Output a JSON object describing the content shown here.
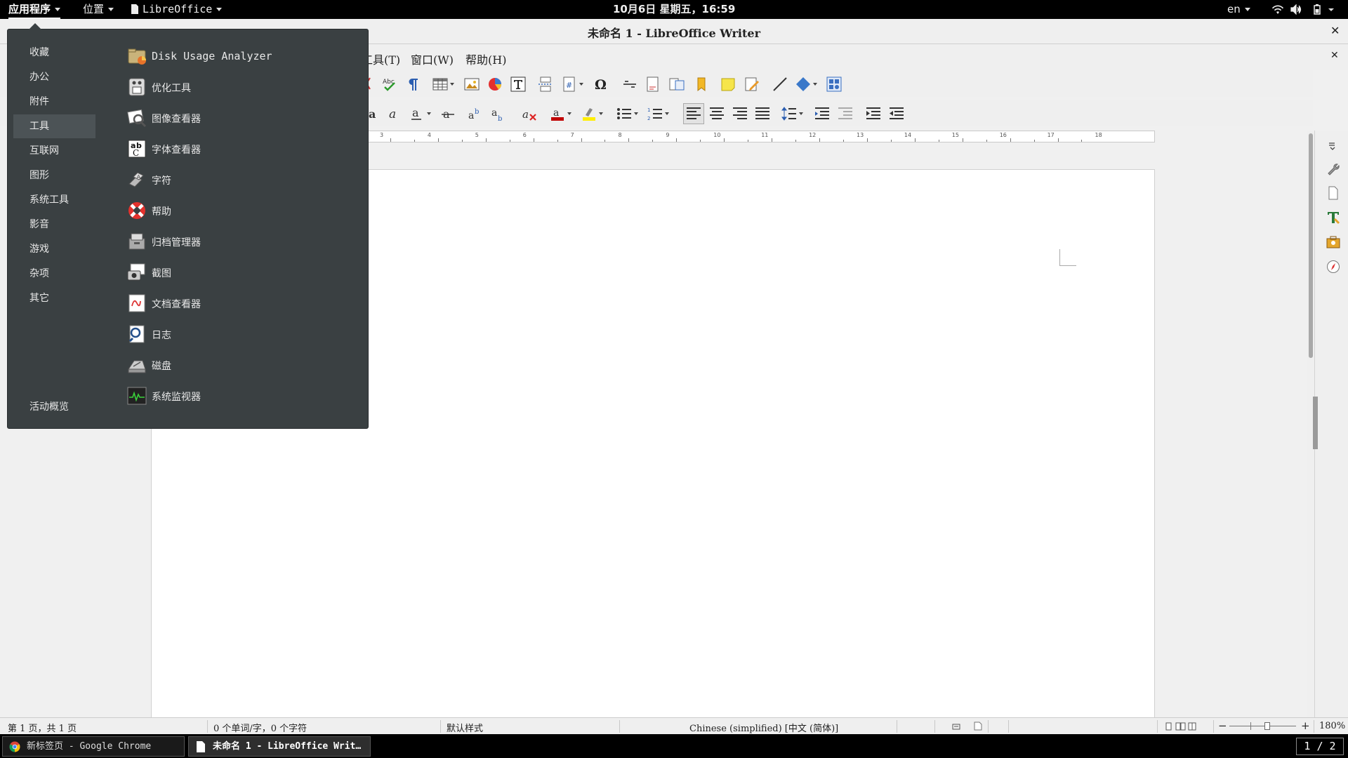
{
  "topbar": {
    "applications": "应用程序",
    "places": "位置",
    "app_name": "LibreOffice",
    "clock": "10月6日  星期五，16:59",
    "lang": "en"
  },
  "window": {
    "title": "未命名 1 - LibreOffice Writer"
  },
  "menubar": {
    "items": [
      "工具(T)",
      "窗口(W)",
      "帮助(H)"
    ]
  },
  "apps_menu": {
    "categories": [
      "收藏",
      "办公",
      "附件",
      "工具",
      "互联网",
      "图形",
      "系统工具",
      "影音",
      "游戏",
      "杂项",
      "其它"
    ],
    "selected_category": "工具",
    "activities": "活动概览",
    "apps": [
      {
        "label": "Disk Usage Analyzer",
        "icon": "disk-usage-analyzer-icon"
      },
      {
        "label": "优化工具",
        "icon": "tweaks-icon"
      },
      {
        "label": "图像查看器",
        "icon": "image-viewer-icon"
      },
      {
        "label": "字体查看器",
        "icon": "font-viewer-icon"
      },
      {
        "label": "字符",
        "icon": "characters-icon"
      },
      {
        "label": "帮助",
        "icon": "help-lifebuoy-icon"
      },
      {
        "label": "归档管理器",
        "icon": "archive-manager-icon"
      },
      {
        "label": "截图",
        "icon": "screenshot-icon"
      },
      {
        "label": "文档查看器",
        "icon": "document-viewer-icon"
      },
      {
        "label": "日志",
        "icon": "logs-icon"
      },
      {
        "label": "磁盘",
        "icon": "disks-icon"
      },
      {
        "label": "系统监视器",
        "icon": "system-monitor-icon"
      }
    ]
  },
  "ruler": {
    "numbers": [
      "3",
      "4",
      "5",
      "6",
      "7",
      "8",
      "9",
      "10",
      "11",
      "12",
      "13",
      "14",
      "15",
      "16",
      "17",
      "18"
    ]
  },
  "statusbar": {
    "page": "第 1 页，共 1 页",
    "words": "0 个单词/字，0 个字符",
    "style": "默认样式",
    "language": "Chinese (simplified) [中文 (简体)]",
    "zoom_minus": "−",
    "zoom_plus": "+",
    "zoom": "180%"
  },
  "taskbar": {
    "tasks": [
      {
        "label": "新标签页 - Google Chrome",
        "icon": "chrome-icon"
      },
      {
        "label": "未命名 1 - LibreOffice Writ…",
        "icon": "document-icon"
      }
    ],
    "workspace": "1 / 2"
  },
  "colors": {
    "menu_bg": "#3a4042",
    "menu_selected": "#4c5356",
    "topbar_bg": "#000000",
    "font_color_red": "#c00000",
    "highlight_yellow": "#ffee00"
  }
}
